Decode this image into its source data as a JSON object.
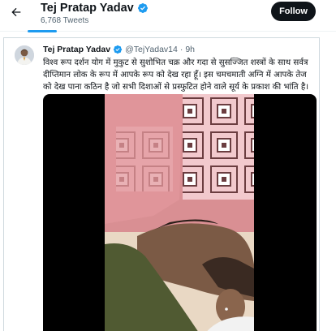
{
  "header": {
    "name": "Tej Pratap Yadav",
    "tweet_count": "6,768 Tweets",
    "follow_label": "Follow"
  },
  "tweet": {
    "author_name": "Tej Pratap Yadav",
    "handle": "@TejYadav14",
    "separator": "·",
    "time": "9h",
    "text": "विश्व रूप दर्शन योग में मुकुट से सुशोभित चक्र और गदा से सुसज्जित शस्त्रों के साथ सर्वत्र दीप्तिमान लोक के रूप में आपके रूप को देख रहा हूँ। इस चमचमाती अग्नि में आपके तेज को देख पाना कठिन है जो सभी दिशाओं से प्रस्फुटित होने वाले सूर्य के प्रकाश की भांति है।"
  },
  "icons": {
    "back": "arrow-left-icon",
    "verified": "verified-badge-icon"
  },
  "colors": {
    "accent": "#1d9bf0",
    "follow_bg": "#0f1419",
    "secondary_text": "#536471",
    "border": "#cfd9de"
  }
}
